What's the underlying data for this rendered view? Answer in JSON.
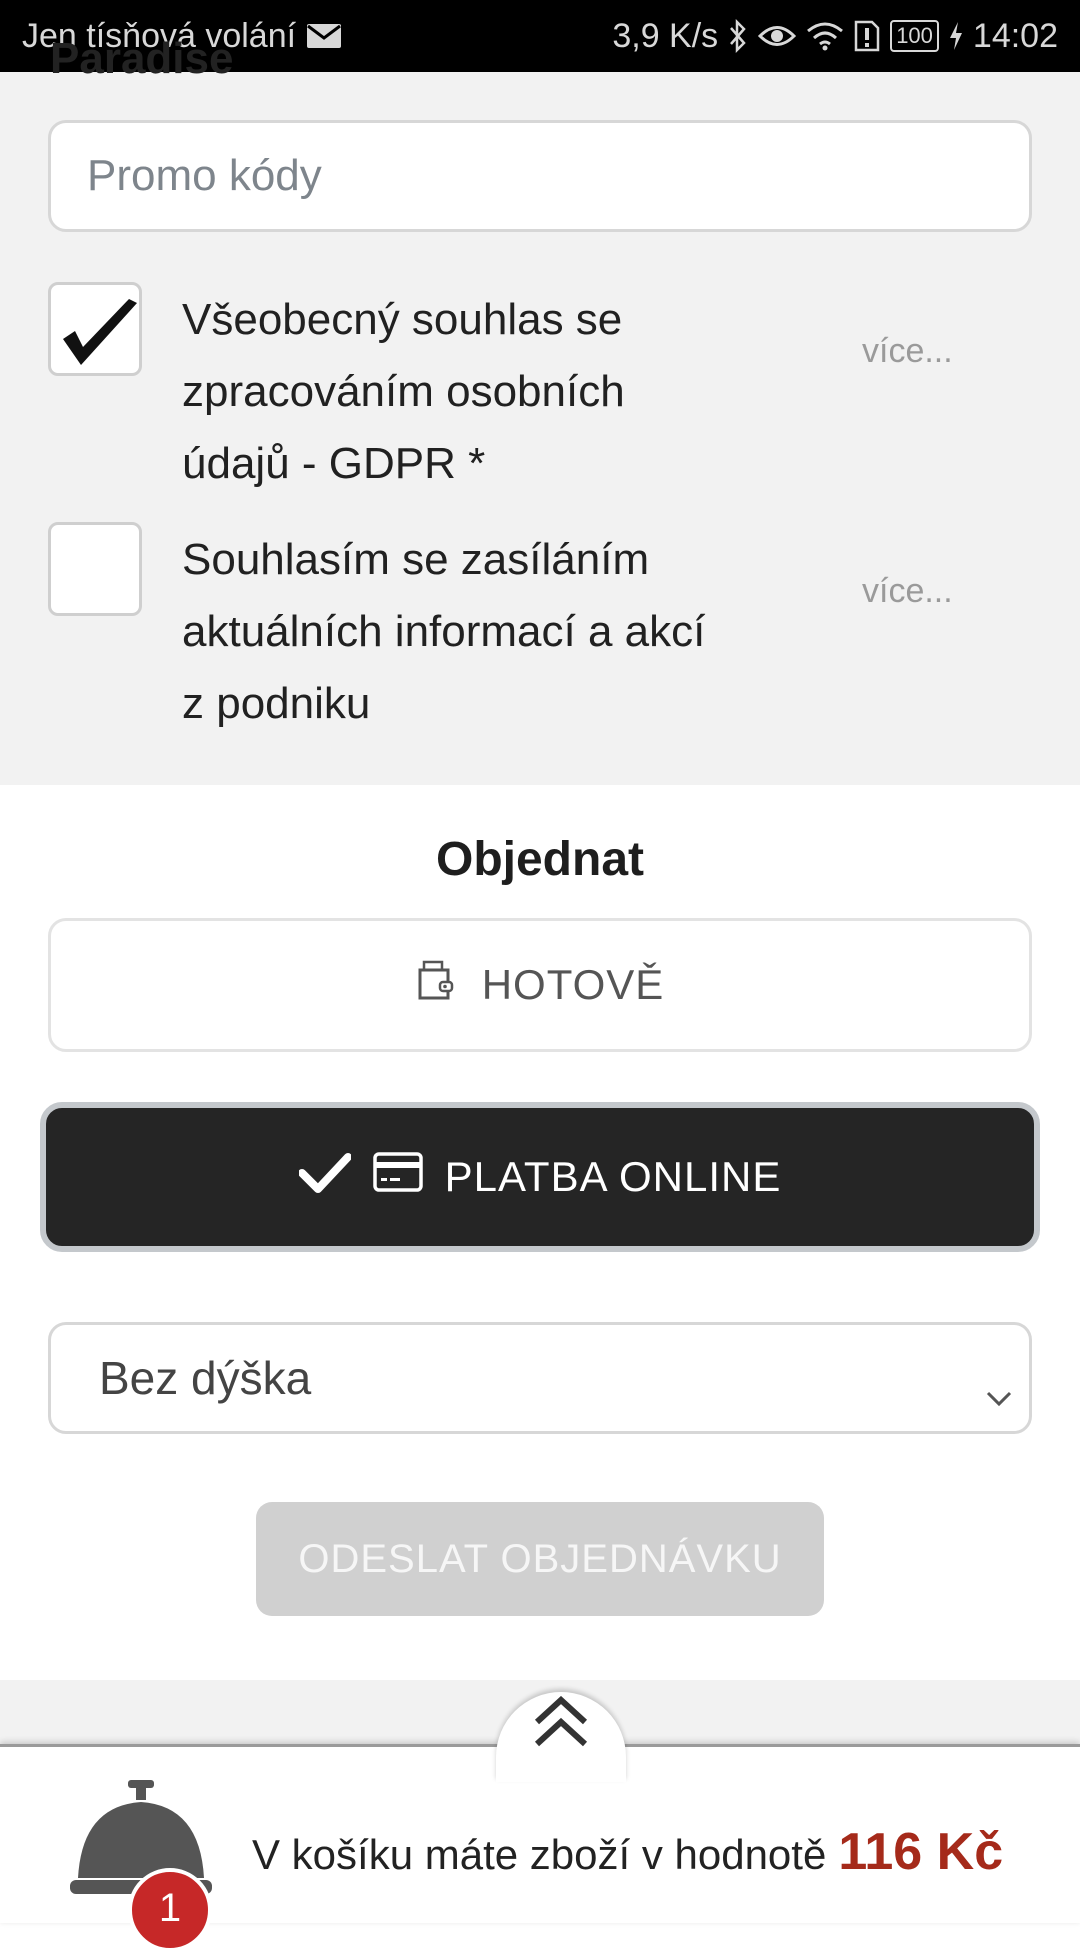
{
  "status_bar": {
    "carrier": "Jen tísňová volání",
    "speed": "3,9 K/s",
    "battery": "100",
    "time": "14:02"
  },
  "form": {
    "section_heading_partial": "Paradise",
    "promo_placeholder": "Promo kódy",
    "consents": [
      {
        "label": "Všeobecný souhlas se zpracováním osobních údajů - GDPR *",
        "checked": true,
        "more": "více..."
      },
      {
        "label": "Souhlasím se zasíláním aktuálních informací a akcí z podniku",
        "checked": false,
        "more": "více..."
      }
    ]
  },
  "order": {
    "title": "Objednat",
    "payment_options": [
      {
        "label": "HOTOVĚ",
        "icon": "wallet-icon",
        "selected": false
      },
      {
        "label": "PLATBA ONLINE",
        "icon": "credit-card-icon",
        "selected": true
      }
    ],
    "tip_select": {
      "value": "Bez dýška",
      "options": [
        "Bez dýška"
      ]
    },
    "submit_label": "ODESLAT OBJEDNÁVKU",
    "submit_enabled": false
  },
  "cart": {
    "text": "V košíku máte zboží v hodnotě",
    "price": "116 Kč",
    "count": "1"
  },
  "colors": {
    "accent_dark": "#252525",
    "price_red": "#a52a1a",
    "badge_red": "#c62828",
    "disabled_gray": "#d0d0d0"
  }
}
